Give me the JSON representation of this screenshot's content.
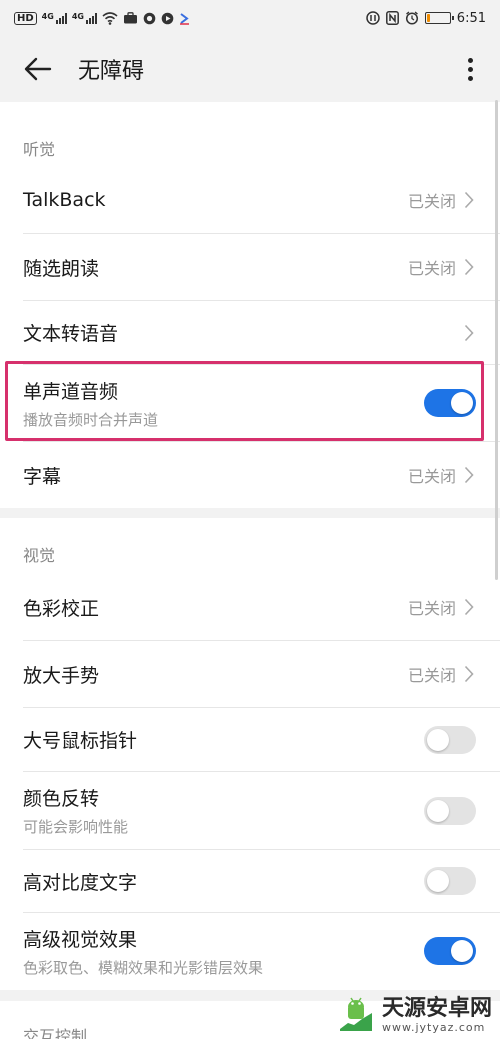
{
  "status_bar": {
    "sim_chip": "HD",
    "net1": "4G",
    "net2": "4G",
    "time": "6:51",
    "icons": [
      "hd-icon",
      "signal-icon",
      "signal-icon",
      "wifi-icon",
      "briefcase-icon",
      "camera-icon",
      "media-icon",
      "arrow-icon",
      "vibrate-icon",
      "nfc-icon",
      "alarm-icon",
      "battery-icon"
    ],
    "battery_level": 0.15
  },
  "app_bar": {
    "title": "无障碍"
  },
  "hearing": {
    "header": "听觉",
    "items": [
      {
        "label": "TalkBack",
        "value": "已关闭"
      },
      {
        "label": "随选朗读",
        "value": "已关闭"
      },
      {
        "label": "文本转语音"
      },
      {
        "label": "单声道音频",
        "sub": "播放音频时合并声道",
        "toggle": true
      },
      {
        "label": "字幕",
        "value": "已关闭"
      }
    ]
  },
  "vision": {
    "header": "视觉",
    "items": [
      {
        "label": "色彩校正",
        "value": "已关闭"
      },
      {
        "label": "放大手势",
        "value": "已关闭"
      },
      {
        "label": "大号鼠标指针",
        "toggle": false
      },
      {
        "label": "颜色反转",
        "sub": "可能会影响性能",
        "toggle": false
      },
      {
        "label": "高对比度文字",
        "toggle": false
      },
      {
        "label": "高级视觉效果",
        "sub": "色彩取色、模糊效果和光影错层效果",
        "toggle": true
      }
    ]
  },
  "interaction": {
    "header": "交互控制"
  },
  "colors": {
    "accent": "#1e74e6",
    "highlight": "#d6306c",
    "toggle_off": "#e3e3e3"
  },
  "watermark": {
    "title": "天源安卓网",
    "url": "www.jytyaz.com"
  }
}
